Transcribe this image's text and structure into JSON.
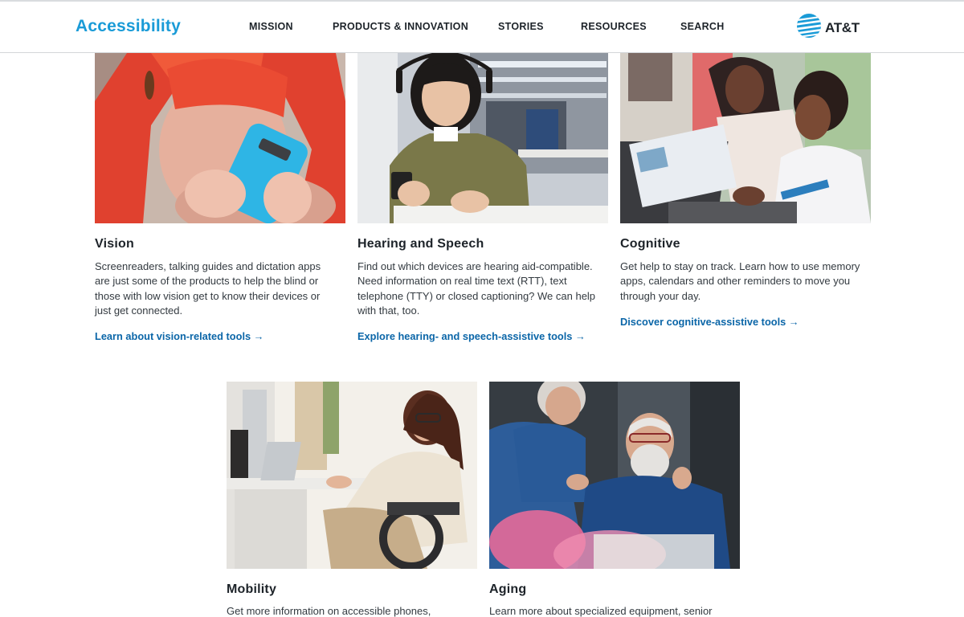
{
  "header": {
    "brand": "Accessibility",
    "nav": [
      "MISSION",
      "PRODUCTS & INNOVATION",
      "STORIES",
      "RESOURCES",
      "SEARCH"
    ],
    "logo_text": "AT&T"
  },
  "colors": {
    "brand_blue": "#1a9bd7",
    "link_blue": "#0b66a8",
    "text_dark": "#1d2329"
  },
  "cards": [
    {
      "title": "Vision",
      "description": "Screenreaders, talking guides and dictation apps are just some of the products to help the blind or those with low vision get to know their devices or just get connected.",
      "link": "Learn about vision-related tools →"
    },
    {
      "title": "Hearing and Speech",
      "description": "Find out which devices are hearing aid-compatible. Need information on real time text (RTT), text telephone (TTY) or closed captioning? We can help with that, too.",
      "link": "Explore hearing- and speech-assistive tools →"
    },
    {
      "title": "Cognitive",
      "description": "Get help to stay on track. Learn how to use memory apps, calendars and other reminders to move you through your day.",
      "link": "Discover cognitive-assistive tools →"
    },
    {
      "title": "Mobility",
      "description": "Get more information on accessible phones,"
    },
    {
      "title": "Aging",
      "description": "Learn more about specialized equipment, senior"
    }
  ]
}
